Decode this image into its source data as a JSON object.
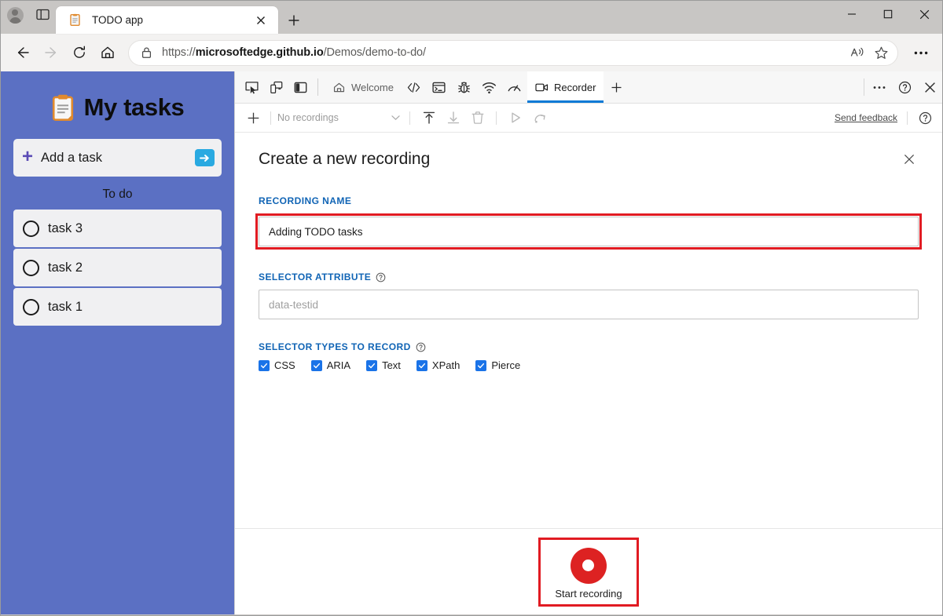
{
  "browser": {
    "profile_icon": "person-avatar-icon",
    "tab_search_icon": "tab-search-icon",
    "tab": {
      "favicon": "clipboard-favicon",
      "title": "TODO app",
      "close_icon": "close-icon"
    },
    "new_tab_icon": "plus-icon",
    "window_controls": {
      "minimize": "minimize-icon",
      "maximize": "maximize-icon",
      "close": "close-icon"
    },
    "nav": {
      "back_icon": "back-arrow-icon",
      "forward_icon": "forward-arrow-icon",
      "reload_icon": "reload-icon",
      "home_icon": "home-icon"
    },
    "omnibox": {
      "security_icon": "lock-icon",
      "url_scheme": "https://",
      "url_host": "microsoftedge.github.io",
      "url_path": "/Demos/demo-to-do/",
      "read_aloud_icon": "read-aloud-icon",
      "favorite_icon": "star-icon"
    },
    "settings_icon": "ellipsis-icon"
  },
  "todo_app": {
    "clipboard_icon": "clipboard-icon",
    "title": "My tasks",
    "add_task": {
      "plus": "+",
      "label": "Add a task",
      "submit_icon": "arrow-right-icon"
    },
    "section_label": "To do",
    "tasks": [
      {
        "label": "task 3"
      },
      {
        "label": "task 2"
      },
      {
        "label": "task 1"
      }
    ],
    "accent_color": "#5b70c3",
    "card_color": "#f0f0f2",
    "submit_color": "#29a9e1"
  },
  "devtools": {
    "tools": [
      {
        "name": "inspect-element-icon"
      },
      {
        "name": "device-emulation-icon"
      },
      {
        "name": "dock-side-icon"
      }
    ],
    "tabs": [
      {
        "label": "Welcome",
        "icon": "home-icon",
        "active": false
      },
      {
        "label": "",
        "icon": "elements-icon",
        "active": false
      },
      {
        "label": "",
        "icon": "console-icon",
        "active": false
      },
      {
        "label": "",
        "icon": "sources-bug-icon",
        "active": false
      },
      {
        "label": "",
        "icon": "network-wifi-icon",
        "active": false
      },
      {
        "label": "",
        "icon": "performance-gauge-icon",
        "active": false
      },
      {
        "label": "Recorder",
        "icon": "recorder-camera-icon",
        "active": true
      }
    ],
    "add_tab_icon": "plus-icon",
    "more_tools_icon": "ellipsis-icon",
    "help_icon": "question-circle-icon",
    "close_icon": "close-icon",
    "active_tab_color": "#0b7ad6"
  },
  "recorder_toolbar": {
    "add_recording_icon": "plus-icon",
    "recordings_select_value": "No recordings",
    "recordings_select_caret": "chevron-down-icon",
    "import_icon": "import-upload-icon",
    "export_icon": "export-download-icon",
    "delete_icon": "trash-icon",
    "replay_icon": "play-triangle-icon",
    "continue_icon": "step-over-icon",
    "send_feedback_label": "Send feedback",
    "help_icon": "question-circle-icon"
  },
  "recording_form": {
    "title": "Create a new recording",
    "close_icon": "close-icon",
    "recording_name": {
      "label": "RECORDING NAME",
      "value": "Adding TODO tasks",
      "highlighted": true
    },
    "selector_attribute": {
      "label": "SELECTOR ATTRIBUTE",
      "help_icon": "question-circle-icon",
      "value": "",
      "placeholder": "data-testid"
    },
    "selector_types": {
      "label": "SELECTOR TYPES TO RECORD",
      "help_icon": "question-circle-icon",
      "options": [
        {
          "label": "CSS",
          "checked": true
        },
        {
          "label": "ARIA",
          "checked": true
        },
        {
          "label": "Text",
          "checked": true
        },
        {
          "label": "XPath",
          "checked": true
        },
        {
          "label": "Pierce",
          "checked": true
        }
      ]
    },
    "start_button": {
      "label": "Start recording",
      "icon": "record-dot-icon",
      "highlighted": true
    },
    "label_color": "#1064b5",
    "highlight_color": "#e11b22",
    "checkbox_color": "#1a73e8",
    "record_color": "#dd2222"
  }
}
